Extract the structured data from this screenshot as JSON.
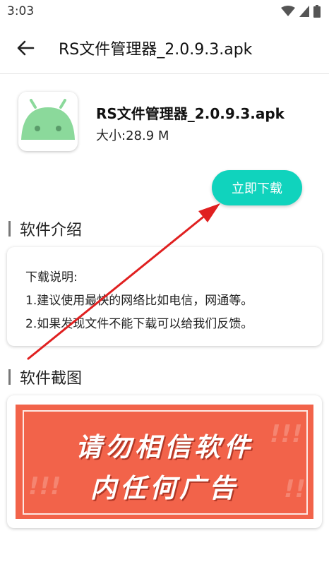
{
  "status_bar": {
    "time": "3:03"
  },
  "app_bar": {
    "title": "RS文件管理器_2.0.9.3.apk",
    "back_icon": "arrow-left-icon"
  },
  "app_info": {
    "name": "RS文件管理器_2.0.9.3.apk",
    "size": "大小:28.9 M",
    "icon": "android-robot-icon"
  },
  "download_button": {
    "label": "立即下载",
    "color": "#10d3bd"
  },
  "intro": {
    "heading": "软件介绍",
    "lines": [
      "下载说明:",
      "1.建议使用最快的网络比如电信，网通等。",
      "2.如果发现文件不能下载可以给我们反馈。"
    ]
  },
  "screenshots": {
    "heading": "软件截图",
    "image_text_line1": "请勿相信软件",
    "image_text_line2": "内任何广告",
    "image_color": "#f2634a"
  },
  "annotation": {
    "arrow_color": "#e02020"
  }
}
